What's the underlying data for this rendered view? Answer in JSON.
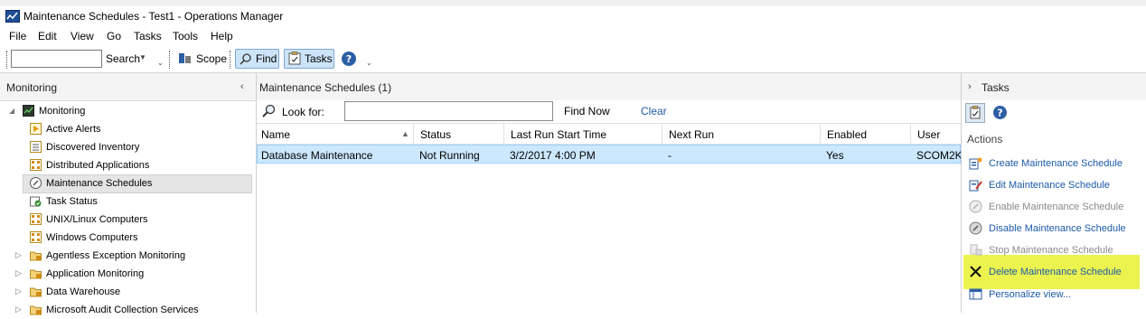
{
  "window": {
    "title": "Maintenance Schedules - Test1 - Operations Manager"
  },
  "menu": [
    "File",
    "Edit",
    "View",
    "Go",
    "Tasks",
    "Tools",
    "Help"
  ],
  "toolbar": {
    "search_value": "",
    "search_label": "Search",
    "scope_label": "Scope",
    "find_label": "Find",
    "tasks_label": "Tasks"
  },
  "left_pane": {
    "header": "Monitoring",
    "root": "Monitoring",
    "items": [
      {
        "label": "Active Alerts",
        "icon": "alert-icon"
      },
      {
        "label": "Discovered Inventory",
        "icon": "inventory-icon"
      },
      {
        "label": "Distributed Applications",
        "icon": "grid-icon"
      },
      {
        "label": "Maintenance Schedules",
        "icon": "wrench-icon",
        "selected": true
      },
      {
        "label": "Task Status",
        "icon": "task-status-icon"
      },
      {
        "label": "UNIX/Linux Computers",
        "icon": "grid-icon"
      },
      {
        "label": "Windows Computers",
        "icon": "grid-icon"
      }
    ],
    "folders": [
      "Agentless Exception Monitoring",
      "Application Monitoring",
      "Data Warehouse",
      "Microsoft Audit Collection Services"
    ]
  },
  "center": {
    "title": "Maintenance Schedules (1)",
    "look_for_label": "Look for:",
    "look_for_value": "",
    "find_now": "Find Now",
    "clear": "Clear",
    "columns": [
      "Name",
      "Status",
      "Last Run Start Time",
      "Next Run",
      "Enabled",
      "User"
    ],
    "rows": [
      [
        "Database Maintenance",
        "Not Running",
        "3/2/2017 4:00 PM",
        "-",
        "Yes",
        "SCOM2K"
      ]
    ]
  },
  "right_pane": {
    "title": "Tasks",
    "section": "Actions",
    "actions": [
      {
        "label": "Create Maintenance Schedule",
        "enabled": true
      },
      {
        "label": "Edit Maintenance Schedule",
        "enabled": true
      },
      {
        "label": "Enable Maintenance Schedule",
        "enabled": false
      },
      {
        "label": "Disable Maintenance Schedule",
        "enabled": true
      },
      {
        "label": "Stop Maintenance Schedule",
        "enabled": false
      },
      {
        "label": "Delete Maintenance Schedule",
        "enabled": true,
        "highlighted": true
      },
      {
        "label": "Personalize view...",
        "enabled": true
      }
    ]
  },
  "colors": {
    "selection_row": "#cce8ff",
    "link_blue": "#1c5aa8",
    "highlight_yellow": "#ecf34f"
  }
}
